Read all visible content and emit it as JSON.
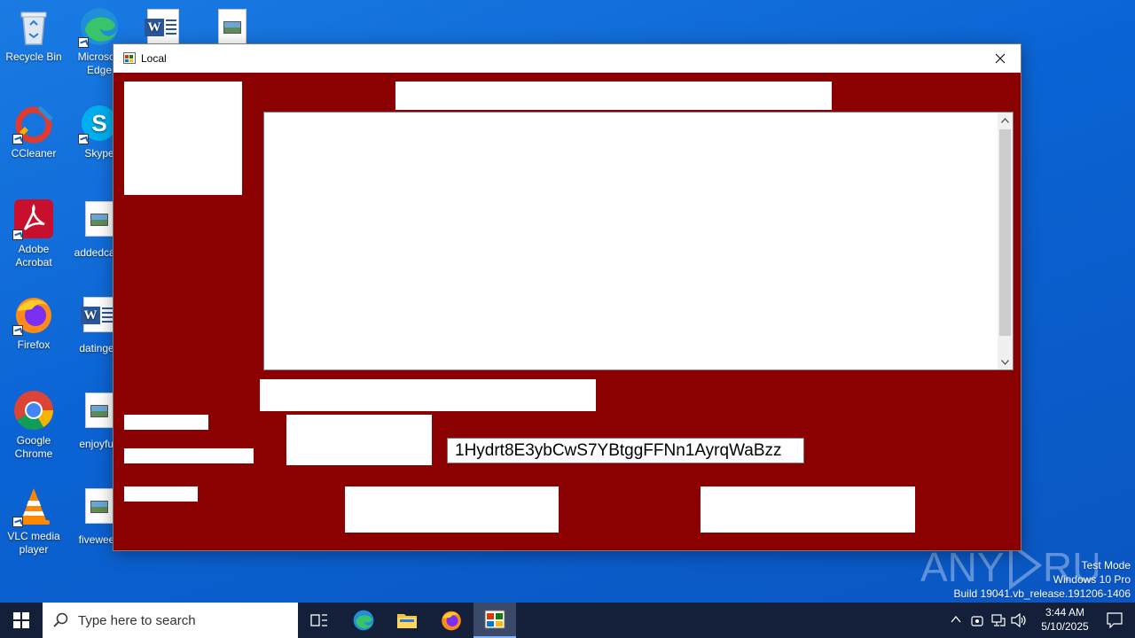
{
  "desktop": {
    "icons": [
      {
        "label": "Recycle Bin"
      },
      {
        "label": "Microsoft Edge"
      },
      {
        "label": "CCleaner"
      },
      {
        "label": "Skype"
      },
      {
        "label": "Adobe Acrobat"
      },
      {
        "label": "addedcard"
      },
      {
        "label": "Firefox"
      },
      {
        "label": "datingex"
      },
      {
        "label": "Google Chrome"
      },
      {
        "label": "enjoyfun"
      },
      {
        "label": "VLC media player"
      },
      {
        "label": "fiveweek"
      }
    ]
  },
  "window": {
    "title": "Local",
    "bitcoin_address": "1Hydrt8E3ybCwS7YBtggFFNn1AyrqWaBzz",
    "background_color": "#8b0000"
  },
  "taskbar": {
    "search_placeholder": "Type here to search",
    "clock_time": "3:44 AM",
    "clock_date": "5/10/2025"
  },
  "watermark": {
    "brand": "ANY RUN",
    "line1": "Test Mode",
    "line2": "Windows 10 Pro",
    "line3": "Build 19041.vb_release.191206-1406"
  }
}
